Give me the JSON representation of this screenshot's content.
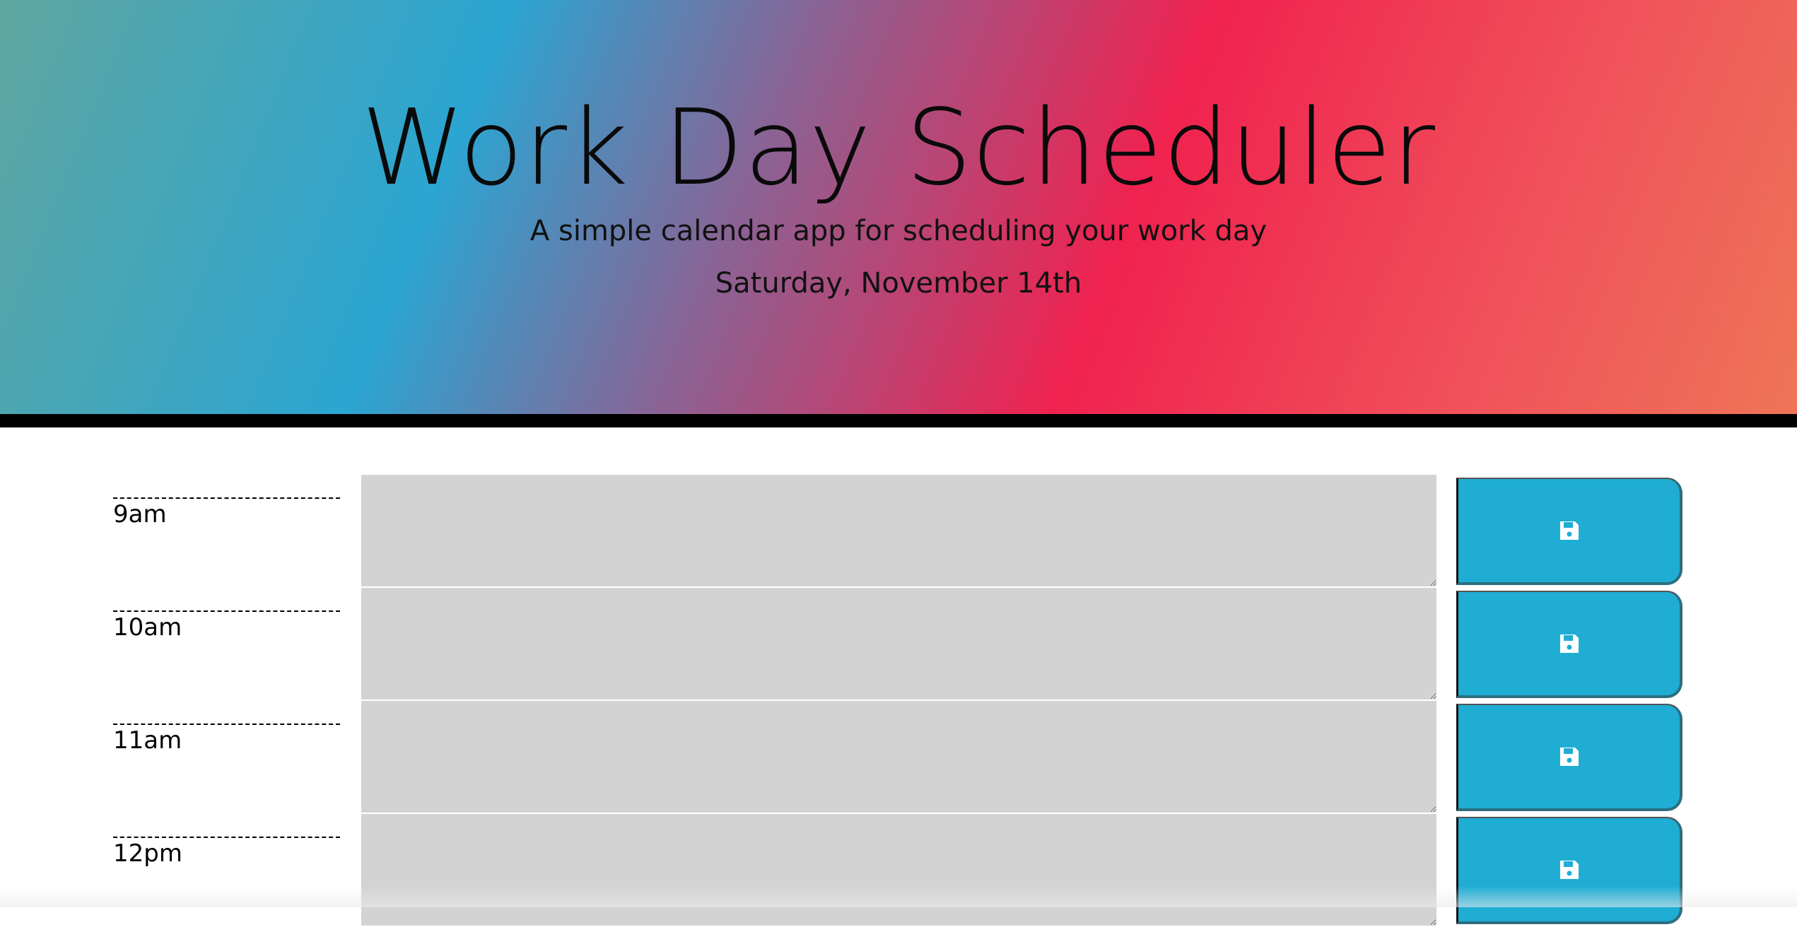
{
  "header": {
    "title": "Work Day Scheduler",
    "subtitle": "A simple calendar app for scheduling your work day",
    "current_day": "Saturday, November 14th",
    "border_color": "#000000"
  },
  "timeblocks": [
    {
      "hour": "9am",
      "description": "",
      "save_icon": "save-icon"
    },
    {
      "hour": "10am",
      "description": "",
      "save_icon": "save-icon"
    },
    {
      "hour": "11am",
      "description": "",
      "save_icon": "save-icon"
    },
    {
      "hour": "12pm",
      "description": "",
      "save_icon": "save-icon"
    }
  ],
  "colors": {
    "past_block": "#d3d3d3",
    "save_button": "#1fadd4"
  }
}
